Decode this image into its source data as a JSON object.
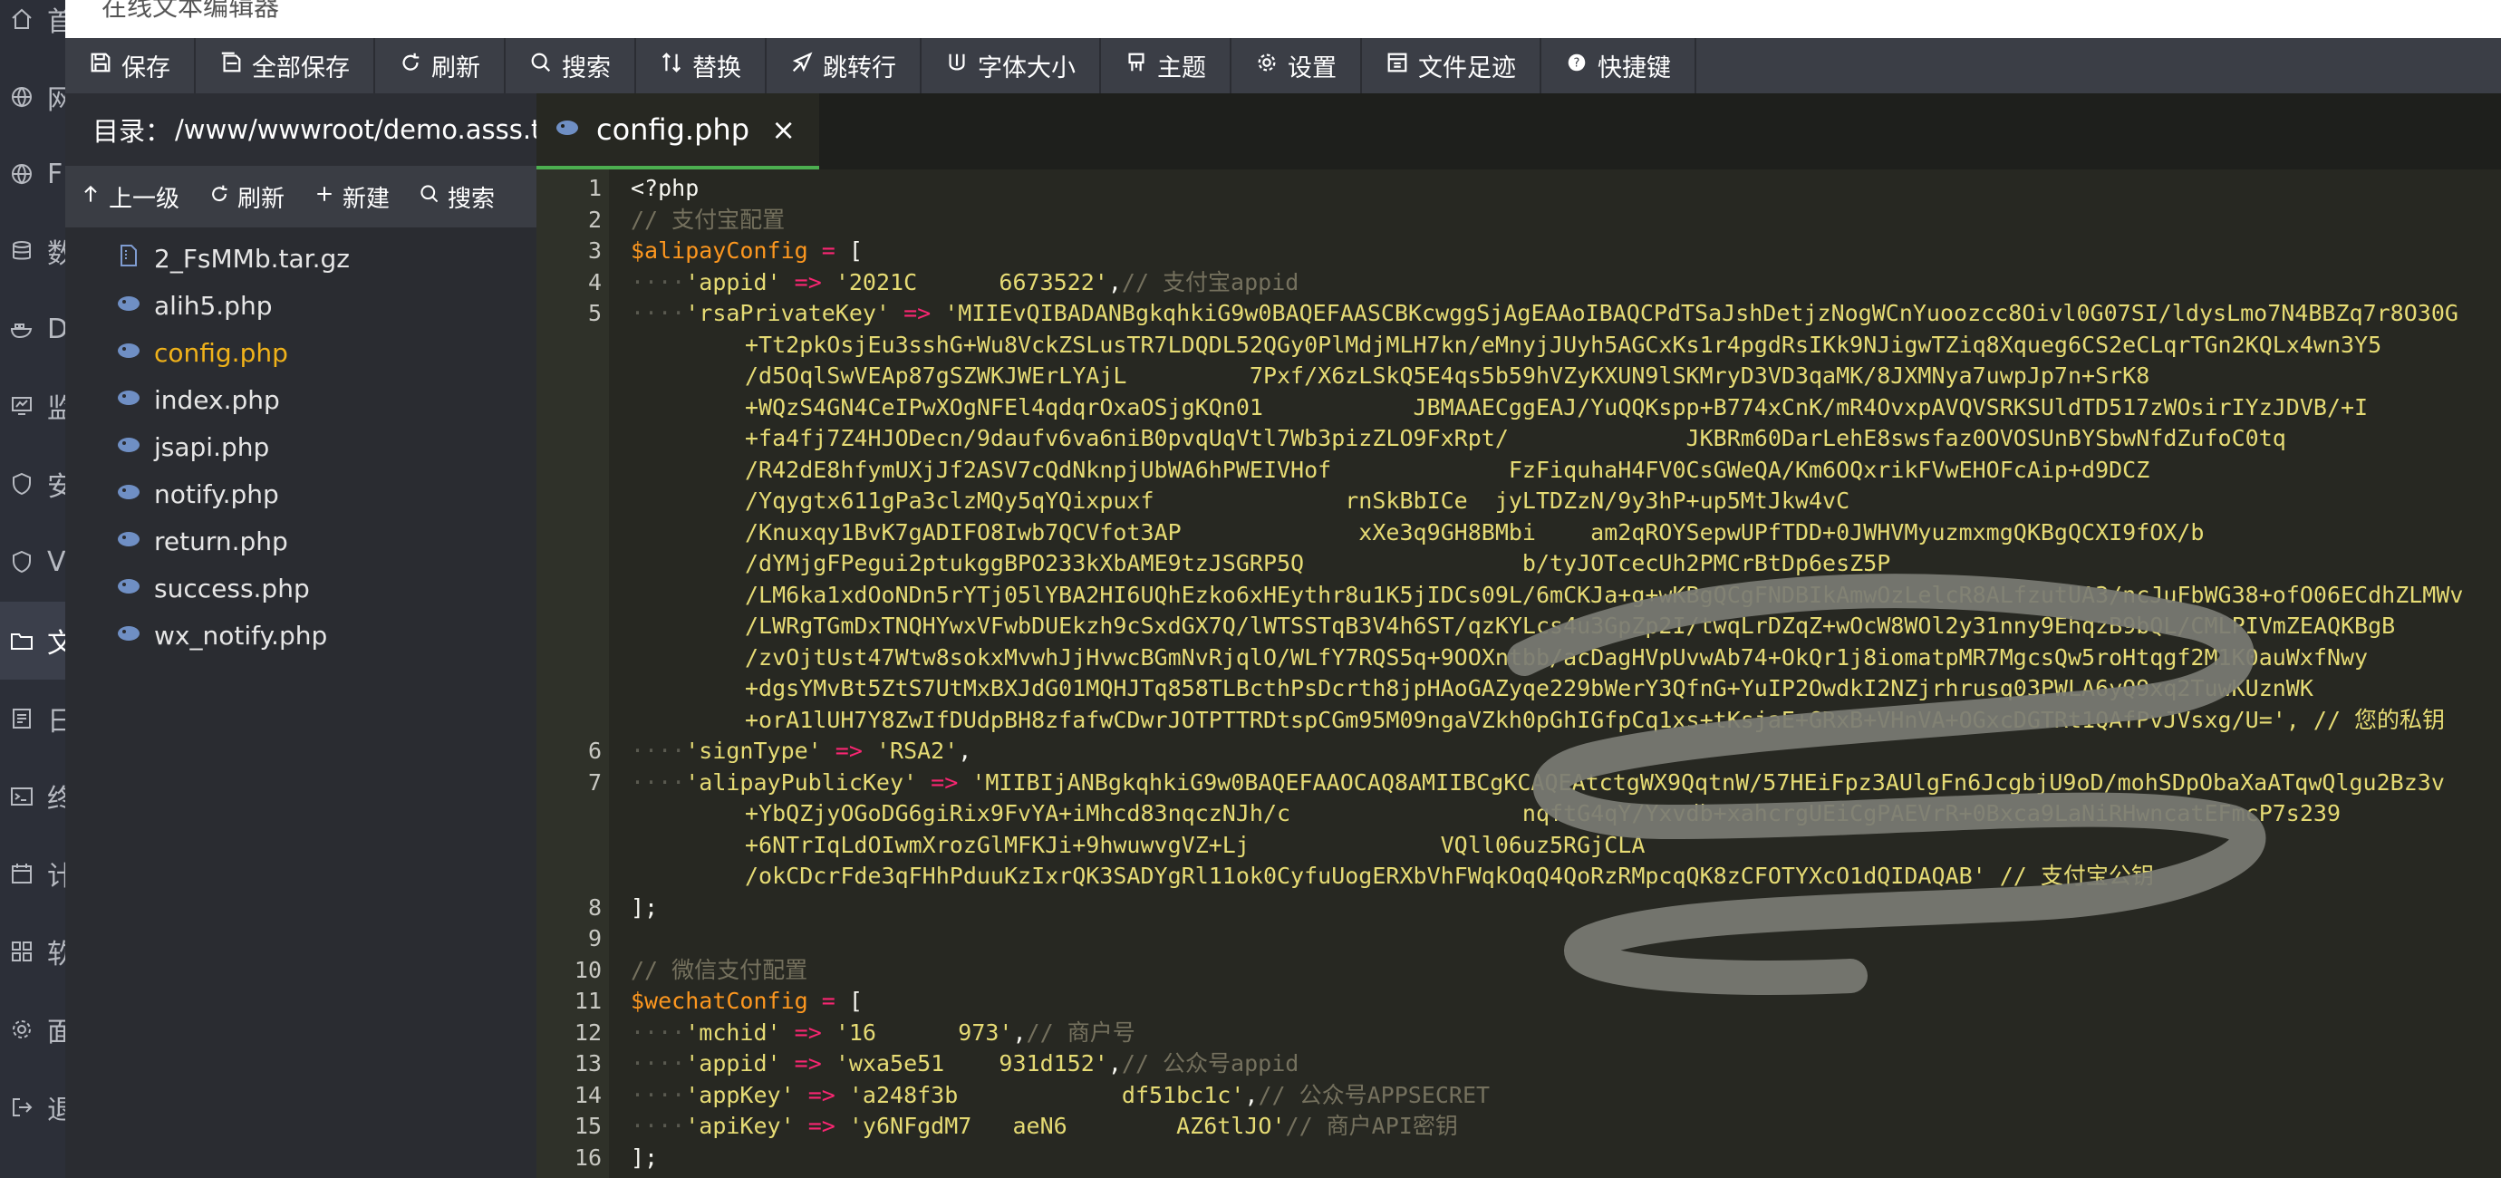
{
  "title": "在线文本编辑器",
  "left_rail": [
    {
      "label": "首",
      "icon": "home-icon"
    },
    {
      "label": "网",
      "icon": "globe-icon"
    },
    {
      "label": "F",
      "icon": "globe-icon"
    },
    {
      "label": "数",
      "icon": "database-icon"
    },
    {
      "label": "D",
      "icon": "docker-icon"
    },
    {
      "label": "监",
      "icon": "monitor-icon"
    },
    {
      "label": "安",
      "icon": "shield-icon"
    },
    {
      "label": "V",
      "icon": "shield-icon"
    },
    {
      "label": "文",
      "icon": "folder-icon"
    },
    {
      "label": "日",
      "icon": "log-icon"
    },
    {
      "label": "终",
      "icon": "terminal-icon"
    },
    {
      "label": "计",
      "icon": "calendar-icon"
    },
    {
      "label": "软",
      "icon": "apps-icon"
    },
    {
      "label": "面",
      "icon": "gear-icon"
    },
    {
      "label": "退",
      "icon": "logout-icon"
    }
  ],
  "toolbar": [
    {
      "label": "保存",
      "icon": "save-icon"
    },
    {
      "label": "全部保存",
      "icon": "save-all-icon"
    },
    {
      "label": "刷新",
      "icon": "refresh-icon"
    },
    {
      "label": "搜索",
      "icon": "search-icon"
    },
    {
      "label": "替换",
      "icon": "replace-icon"
    },
    {
      "label": "跳转行",
      "icon": "goto-line-icon"
    },
    {
      "label": "字体大小",
      "icon": "font-size-icon"
    },
    {
      "label": "主题",
      "icon": "theme-icon"
    },
    {
      "label": "设置",
      "icon": "gear-icon"
    },
    {
      "label": "文件足迹",
      "icon": "history-icon"
    },
    {
      "label": "快捷键",
      "icon": "help-icon"
    }
  ],
  "file_panel": {
    "dir_label": "目录：",
    "dir_path": "/www/wwwroot/demo.asss.t...",
    "actions": [
      {
        "label": "上一级",
        "icon": "arrow-up-icon"
      },
      {
        "label": "刷新",
        "icon": "refresh-icon"
      },
      {
        "label": "新建",
        "icon": "plus-icon"
      },
      {
        "label": "搜索",
        "icon": "search-icon"
      }
    ],
    "files": [
      {
        "name": "2_FsMMb.tar.gz",
        "icon": "archive-file-icon",
        "selected": false
      },
      {
        "name": "alih5.php",
        "icon": "php-file-icon",
        "selected": false
      },
      {
        "name": "config.php",
        "icon": "php-file-icon",
        "selected": true
      },
      {
        "name": "index.php",
        "icon": "php-file-icon",
        "selected": false
      },
      {
        "name": "jsapi.php",
        "icon": "php-file-icon",
        "selected": false
      },
      {
        "name": "notify.php",
        "icon": "php-file-icon",
        "selected": false
      },
      {
        "name": "return.php",
        "icon": "php-file-icon",
        "selected": false
      },
      {
        "name": "success.php",
        "icon": "php-file-icon",
        "selected": false
      },
      {
        "name": "wx_notify.php",
        "icon": "php-file-icon",
        "selected": false
      }
    ]
  },
  "editor": {
    "tab_label": "config.php",
    "tab_close": "×",
    "lines": [
      {
        "n": "1",
        "text": "<?php"
      },
      {
        "n": "2",
        "text": "// 支付宝配置"
      },
      {
        "n": "3",
        "text": "$alipayConfig = ["
      },
      {
        "n": "4",
        "text": "    'appid' => '2021C      6673522',// 支付宝appid"
      },
      {
        "n": "5",
        "text": "    'rsaPrivateKey' => 'MIIEvQIBADANBgkqhkiG9w0BAQEFAASCBKcwggSjAgEAAoIBAQCPdTSaJshDetjzNogWCnYuoozcc8Oivl0G07SI/ldysLmo7N4BBZq7r8O30G"
      },
      {
        "n": "",
        "text": "+Tt2pkOsjEu3sshG+Wu8VckZSLusTR7LDQDL52QGy0PlMdjMLH7kn/eMnyjJUyh5AGCxKs1r4pgdRsIKk9NJigwTZiq8Xqueg6CS2eCLqrTGn2KQLx4wn3Y5"
      },
      {
        "n": "",
        "text": "/d5OqlSwVEAp87gSZWKJWErLYAjL         7Pxf/X6zLSkQ5E4qs5b59hVZyKXUN9lSKMryD3VD3qaMK/8JXMNya7uwpJp7n+SrK8"
      },
      {
        "n": "",
        "text": "+WQzS4GN4CeIPwXOgNFEl4qdqrOxaOSjgKQn01           JBMAAECggEAJ/YuQQKspp+B774xCnK/mR4OvxpAVQVSRKSUldTD517zWOsirIYzJDVB/+I"
      },
      {
        "n": "",
        "text": "+fa4fj7Z4HJODecn/9daufv6va6niB0pvqUqVtl7Wb3pizZLO9FxRpt/             JKBRm60DarLehE8swsfaz0OVOSUnBYSbwNfdZufoC0tq"
      },
      {
        "n": "",
        "text": "/R42dE8hfymUXjJf2ASV7cQdNknpjUbWA6hPWEIVHof             FzFiquhaH4FV0CsGWeQA/Km6OQxrikFVwEHOFcAip+d9DCZ"
      },
      {
        "n": "",
        "text": "/Yqygtx611gPa3clzMQy5qYQixpuxf              rnSkBbICe  jyLTDZzN/9y3hP+up5MtJkw4vC"
      },
      {
        "n": "",
        "text": "/Knuxqy1BvK7gADIFO8Iwb7QCVfot3AP             xXe3q9GH8BMbi    am2qROYSepwUPfTDD+0JWHVMyuzmxmgQKBgQCXI9fOX/b"
      },
      {
        "n": "",
        "text": "/dYMjgFPegui2ptukggBPO233kXbAME9tzJSGRP5Q                b/tyJOTcecUh2PMCrBtDp6esZ5P"
      },
      {
        "n": "",
        "text": "/LM6ka1xdOoNDn5rYTj05lYBA2HI6UQhEzko6xHEythr8u1K5jIDCs09L/6mCKJa+g+wKBgQCgFNDBIkAmwOzLelcR8ALfzutUA3/ncJuFbWG38+ofO06ECdhZLMWv"
      },
      {
        "n": "",
        "text": "/LWRgTGmDxTNQHYwxVFwbDUEkzh9cSxdGX7Q/lWTSSTqB3V4h6ST/qzKYLcs4u3GpZp2I/twqLrDZqZ+wOcW8WOl2y31nny9EhqzB9bQL/CMLPIVmZEAQKBgB"
      },
      {
        "n": "",
        "text": "/zvOjtUst47Wtw8sokxMvwhJjHvwcBGmNvRjqlO/WLfY7RQS5q+9OOXntbb/acDagHVpUvwAb74+OkQr1j8iomatpMR7MgcsQw5roHtqgf2M1K0auWxfNwy"
      },
      {
        "n": "",
        "text": "+dgsYMvBt5ZtS7UtMxBXJdG01MQHJTq858TLBcthPsDcrth8jpHAoGAZyqe229bWerY3QfnG+YuIP2OwdkI2NZjrhrusq03PWLA6yQ9xq2TuwKUznWK"
      },
      {
        "n": "",
        "text": "+orA1lUH7Y8ZwIfDUdpBH8zfafwCDwrJOTPTTRDtspCGm95M09ngaVZkh0pGhIGfpCq1xs+tKsjaE+GRxB+VHnVA+OGxcDGTRt1QAfPvJVsxg/U=', // 您的私钥"
      },
      {
        "n": "6",
        "text": "    'signType' => 'RSA2',"
      },
      {
        "n": "7",
        "text": "    'alipayPublicKey' => 'MIIBIjANBgkqhkiG9w0BAQEFAAOCAQ8AMIIBCgKCAQEAtctgWX9QqtnW/57HEiFpz3AUlgFn6JcgbjU9oD/mohSDpObaXaATqwQlgu2Bz3v"
      },
      {
        "n": "",
        "text": "+YbQZjyOGoDG6giRix9FvYA+iMhcd83nqczNJh/c                 nqftG4qY/Yxvdb+xahcrgUEiCgPAEVrR+0Bxca9LaNiRHwncatEFmcP7s239"
      },
      {
        "n": "",
        "text": "+6NTrIqLdOIwmXrozGlMFKJi+9hwuwvgVZ+Lj              VQll06uz5RGjCLA"
      },
      {
        "n": "",
        "text": "/okCDcrFde3qFHhPduuKzIxrQK3SADYgRl11ok0CyfuUogERXbVhFWqkOqQ4QoRzRMpcqQK8zCFOTYXcO1dQIDAQAB' // 支付宝公钥"
      },
      {
        "n": "8",
        "text": "];"
      },
      {
        "n": "9",
        "text": ""
      },
      {
        "n": "10",
        "text": "// 微信支付配置"
      },
      {
        "n": "11",
        "text": "$wechatConfig = ["
      },
      {
        "n": "12",
        "text": "    'mchid' => '16      973',// 商户号"
      },
      {
        "n": "13",
        "text": "    'appid' => 'wxa5e51    931d152',// 公众号appid"
      },
      {
        "n": "14",
        "text": "    'appKey' => 'a248f3b            df51bc1c',// 公众号APPSECRET"
      },
      {
        "n": "15",
        "text": "    'apiKey' => 'y6NFgdM7   aeN6        AZ6tlJO'// 商户API密钥"
      },
      {
        "n": "16",
        "text": "];"
      },
      {
        "n": "17",
        "text": ""
      }
    ]
  },
  "colors": {
    "toolbar_bg": "#3b3e46",
    "editor_bg": "#272822",
    "gutter_bg": "#2f3129",
    "string": "#e6db74",
    "variable": "#fd971f",
    "operator": "#f92672",
    "comment": "#75715e",
    "selected_file": "#f0b21a",
    "tab_underline": "#4caf50"
  }
}
